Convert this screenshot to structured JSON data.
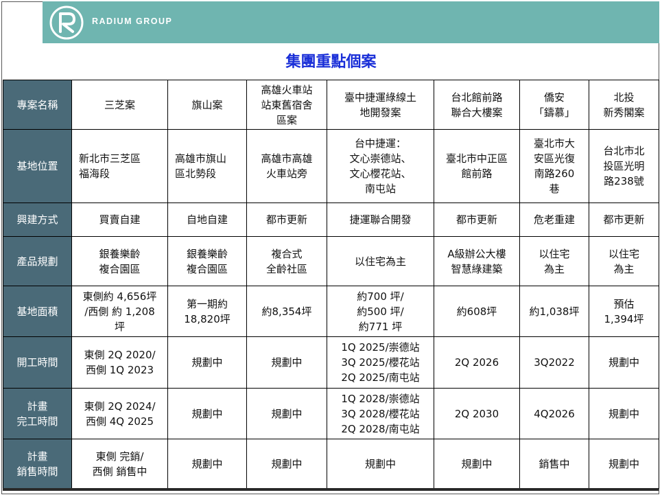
{
  "header": {
    "brand": "RADIUM GROUP",
    "brand_color": "#6fb5b0",
    "logo_icon": "radium-logo-icon"
  },
  "title": "集團重點個案",
  "title_color": "#1a2fd8",
  "table": {
    "header_color": "#4a6a78",
    "rows": [
      {
        "label": "專案名稱",
        "cells": [
          "三芝案",
          "旗山案",
          "高雄火車站\n站東舊宿舍\n區案",
          "臺中捷運綠線土\n地開發案",
          "台北館前路\n聯合大樓案",
          "僑安\n「鑄慕」",
          "北投\n新秀閣案"
        ]
      },
      {
        "label": "基地位置",
        "cells": [
          "新北市三芝區\n福海段",
          "高雄市旗山\n區北勢段",
          "高雄市高雄\n火車站旁",
          "台中捷運：\n文心崇德站、\n文心櫻花站、\n南屯站",
          "臺北市中正區\n館前路",
          "臺北市大\n安區光復\n南路260\n巷",
          "台北市北\n投區光明\n路238號"
        ]
      },
      {
        "label": "興建方式",
        "cells": [
          "買賣自建",
          "自地自建",
          "都市更新",
          "捷運聯合開發",
          "都市更新",
          "危老重建",
          "都市更新"
        ]
      },
      {
        "label": "產品規劃",
        "cells": [
          "銀養樂齡\n複合園區",
          "銀養樂齡\n複合園區",
          "複合式\n全齡社區",
          "以住宅為主",
          "A級辦公大樓\n智慧綠建築",
          "以住宅\n為主",
          "以住宅\n為主"
        ]
      },
      {
        "label": "基地面積",
        "cells": [
          "東側約 4,656坪\n/西側 約 1,208\n坪",
          "第一期約\n18,820坪",
          "約8,354坪",
          "約700 坪/\n約500 坪/\n約771 坪",
          "約608坪",
          "約1,038坪",
          "預估\n1,394坪"
        ]
      },
      {
        "label": "開工時間",
        "cells": [
          "東側 2Q 2020/\n西側 1Q 2023",
          "規劃中",
          "規劃中",
          "1Q 2025/崇德站\n3Q 2025/櫻花站\n2Q 2025/南屯站",
          "2Q 2026",
          "3Q2022",
          "規劃中"
        ]
      },
      {
        "label": "計畫\n完工時間",
        "cells": [
          "東側 2Q 2024/\n西側 4Q 2025",
          "規劃中",
          "規劃中",
          "1Q 2028/崇德站\n3Q 2028/櫻花站\n2Q 2028/南屯站",
          "2Q 2030",
          "4Q2026",
          "規劃中"
        ]
      },
      {
        "label": "計畫\n銷售時間",
        "cells": [
          "東側 完銷/\n西側 銷售中",
          "規劃中",
          "規劃中",
          "規劃中",
          "規劃中",
          "銷售中",
          "規劃中"
        ]
      }
    ]
  }
}
